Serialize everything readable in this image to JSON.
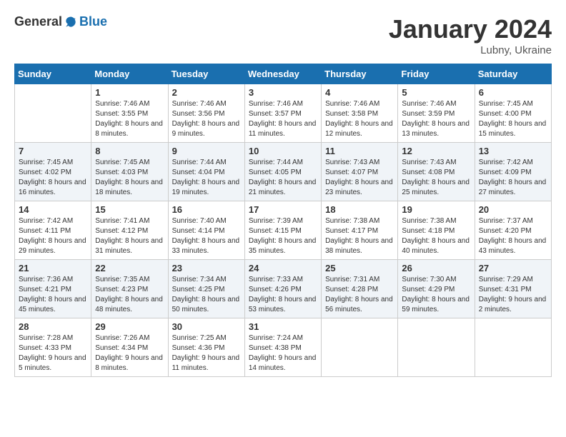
{
  "header": {
    "logo_general": "General",
    "logo_blue": "Blue",
    "month_title": "January 2024",
    "location": "Lubny, Ukraine"
  },
  "weekdays": [
    "Sunday",
    "Monday",
    "Tuesday",
    "Wednesday",
    "Thursday",
    "Friday",
    "Saturday"
  ],
  "weeks": [
    [
      {
        "day": "",
        "sunrise": "",
        "sunset": "",
        "daylight": ""
      },
      {
        "day": "1",
        "sunrise": "Sunrise: 7:46 AM",
        "sunset": "Sunset: 3:55 PM",
        "daylight": "Daylight: 8 hours and 8 minutes."
      },
      {
        "day": "2",
        "sunrise": "Sunrise: 7:46 AM",
        "sunset": "Sunset: 3:56 PM",
        "daylight": "Daylight: 8 hours and 9 minutes."
      },
      {
        "day": "3",
        "sunrise": "Sunrise: 7:46 AM",
        "sunset": "Sunset: 3:57 PM",
        "daylight": "Daylight: 8 hours and 11 minutes."
      },
      {
        "day": "4",
        "sunrise": "Sunrise: 7:46 AM",
        "sunset": "Sunset: 3:58 PM",
        "daylight": "Daylight: 8 hours and 12 minutes."
      },
      {
        "day": "5",
        "sunrise": "Sunrise: 7:46 AM",
        "sunset": "Sunset: 3:59 PM",
        "daylight": "Daylight: 8 hours and 13 minutes."
      },
      {
        "day": "6",
        "sunrise": "Sunrise: 7:45 AM",
        "sunset": "Sunset: 4:00 PM",
        "daylight": "Daylight: 8 hours and 15 minutes."
      }
    ],
    [
      {
        "day": "7",
        "sunrise": "Sunrise: 7:45 AM",
        "sunset": "Sunset: 4:02 PM",
        "daylight": "Daylight: 8 hours and 16 minutes."
      },
      {
        "day": "8",
        "sunrise": "Sunrise: 7:45 AM",
        "sunset": "Sunset: 4:03 PM",
        "daylight": "Daylight: 8 hours and 18 minutes."
      },
      {
        "day": "9",
        "sunrise": "Sunrise: 7:44 AM",
        "sunset": "Sunset: 4:04 PM",
        "daylight": "Daylight: 8 hours and 19 minutes."
      },
      {
        "day": "10",
        "sunrise": "Sunrise: 7:44 AM",
        "sunset": "Sunset: 4:05 PM",
        "daylight": "Daylight: 8 hours and 21 minutes."
      },
      {
        "day": "11",
        "sunrise": "Sunrise: 7:43 AM",
        "sunset": "Sunset: 4:07 PM",
        "daylight": "Daylight: 8 hours and 23 minutes."
      },
      {
        "day": "12",
        "sunrise": "Sunrise: 7:43 AM",
        "sunset": "Sunset: 4:08 PM",
        "daylight": "Daylight: 8 hours and 25 minutes."
      },
      {
        "day": "13",
        "sunrise": "Sunrise: 7:42 AM",
        "sunset": "Sunset: 4:09 PM",
        "daylight": "Daylight: 8 hours and 27 minutes."
      }
    ],
    [
      {
        "day": "14",
        "sunrise": "Sunrise: 7:42 AM",
        "sunset": "Sunset: 4:11 PM",
        "daylight": "Daylight: 8 hours and 29 minutes."
      },
      {
        "day": "15",
        "sunrise": "Sunrise: 7:41 AM",
        "sunset": "Sunset: 4:12 PM",
        "daylight": "Daylight: 8 hours and 31 minutes."
      },
      {
        "day": "16",
        "sunrise": "Sunrise: 7:40 AM",
        "sunset": "Sunset: 4:14 PM",
        "daylight": "Daylight: 8 hours and 33 minutes."
      },
      {
        "day": "17",
        "sunrise": "Sunrise: 7:39 AM",
        "sunset": "Sunset: 4:15 PM",
        "daylight": "Daylight: 8 hours and 35 minutes."
      },
      {
        "day": "18",
        "sunrise": "Sunrise: 7:38 AM",
        "sunset": "Sunset: 4:17 PM",
        "daylight": "Daylight: 8 hours and 38 minutes."
      },
      {
        "day": "19",
        "sunrise": "Sunrise: 7:38 AM",
        "sunset": "Sunset: 4:18 PM",
        "daylight": "Daylight: 8 hours and 40 minutes."
      },
      {
        "day": "20",
        "sunrise": "Sunrise: 7:37 AM",
        "sunset": "Sunset: 4:20 PM",
        "daylight": "Daylight: 8 hours and 43 minutes."
      }
    ],
    [
      {
        "day": "21",
        "sunrise": "Sunrise: 7:36 AM",
        "sunset": "Sunset: 4:21 PM",
        "daylight": "Daylight: 8 hours and 45 minutes."
      },
      {
        "day": "22",
        "sunrise": "Sunrise: 7:35 AM",
        "sunset": "Sunset: 4:23 PM",
        "daylight": "Daylight: 8 hours and 48 minutes."
      },
      {
        "day": "23",
        "sunrise": "Sunrise: 7:34 AM",
        "sunset": "Sunset: 4:25 PM",
        "daylight": "Daylight: 8 hours and 50 minutes."
      },
      {
        "day": "24",
        "sunrise": "Sunrise: 7:33 AM",
        "sunset": "Sunset: 4:26 PM",
        "daylight": "Daylight: 8 hours and 53 minutes."
      },
      {
        "day": "25",
        "sunrise": "Sunrise: 7:31 AM",
        "sunset": "Sunset: 4:28 PM",
        "daylight": "Daylight: 8 hours and 56 minutes."
      },
      {
        "day": "26",
        "sunrise": "Sunrise: 7:30 AM",
        "sunset": "Sunset: 4:29 PM",
        "daylight": "Daylight: 8 hours and 59 minutes."
      },
      {
        "day": "27",
        "sunrise": "Sunrise: 7:29 AM",
        "sunset": "Sunset: 4:31 PM",
        "daylight": "Daylight: 9 hours and 2 minutes."
      }
    ],
    [
      {
        "day": "28",
        "sunrise": "Sunrise: 7:28 AM",
        "sunset": "Sunset: 4:33 PM",
        "daylight": "Daylight: 9 hours and 5 minutes."
      },
      {
        "day": "29",
        "sunrise": "Sunrise: 7:26 AM",
        "sunset": "Sunset: 4:34 PM",
        "daylight": "Daylight: 9 hours and 8 minutes."
      },
      {
        "day": "30",
        "sunrise": "Sunrise: 7:25 AM",
        "sunset": "Sunset: 4:36 PM",
        "daylight": "Daylight: 9 hours and 11 minutes."
      },
      {
        "day": "31",
        "sunrise": "Sunrise: 7:24 AM",
        "sunset": "Sunset: 4:38 PM",
        "daylight": "Daylight: 9 hours and 14 minutes."
      },
      {
        "day": "",
        "sunrise": "",
        "sunset": "",
        "daylight": ""
      },
      {
        "day": "",
        "sunrise": "",
        "sunset": "",
        "daylight": ""
      },
      {
        "day": "",
        "sunrise": "",
        "sunset": "",
        "daylight": ""
      }
    ]
  ]
}
